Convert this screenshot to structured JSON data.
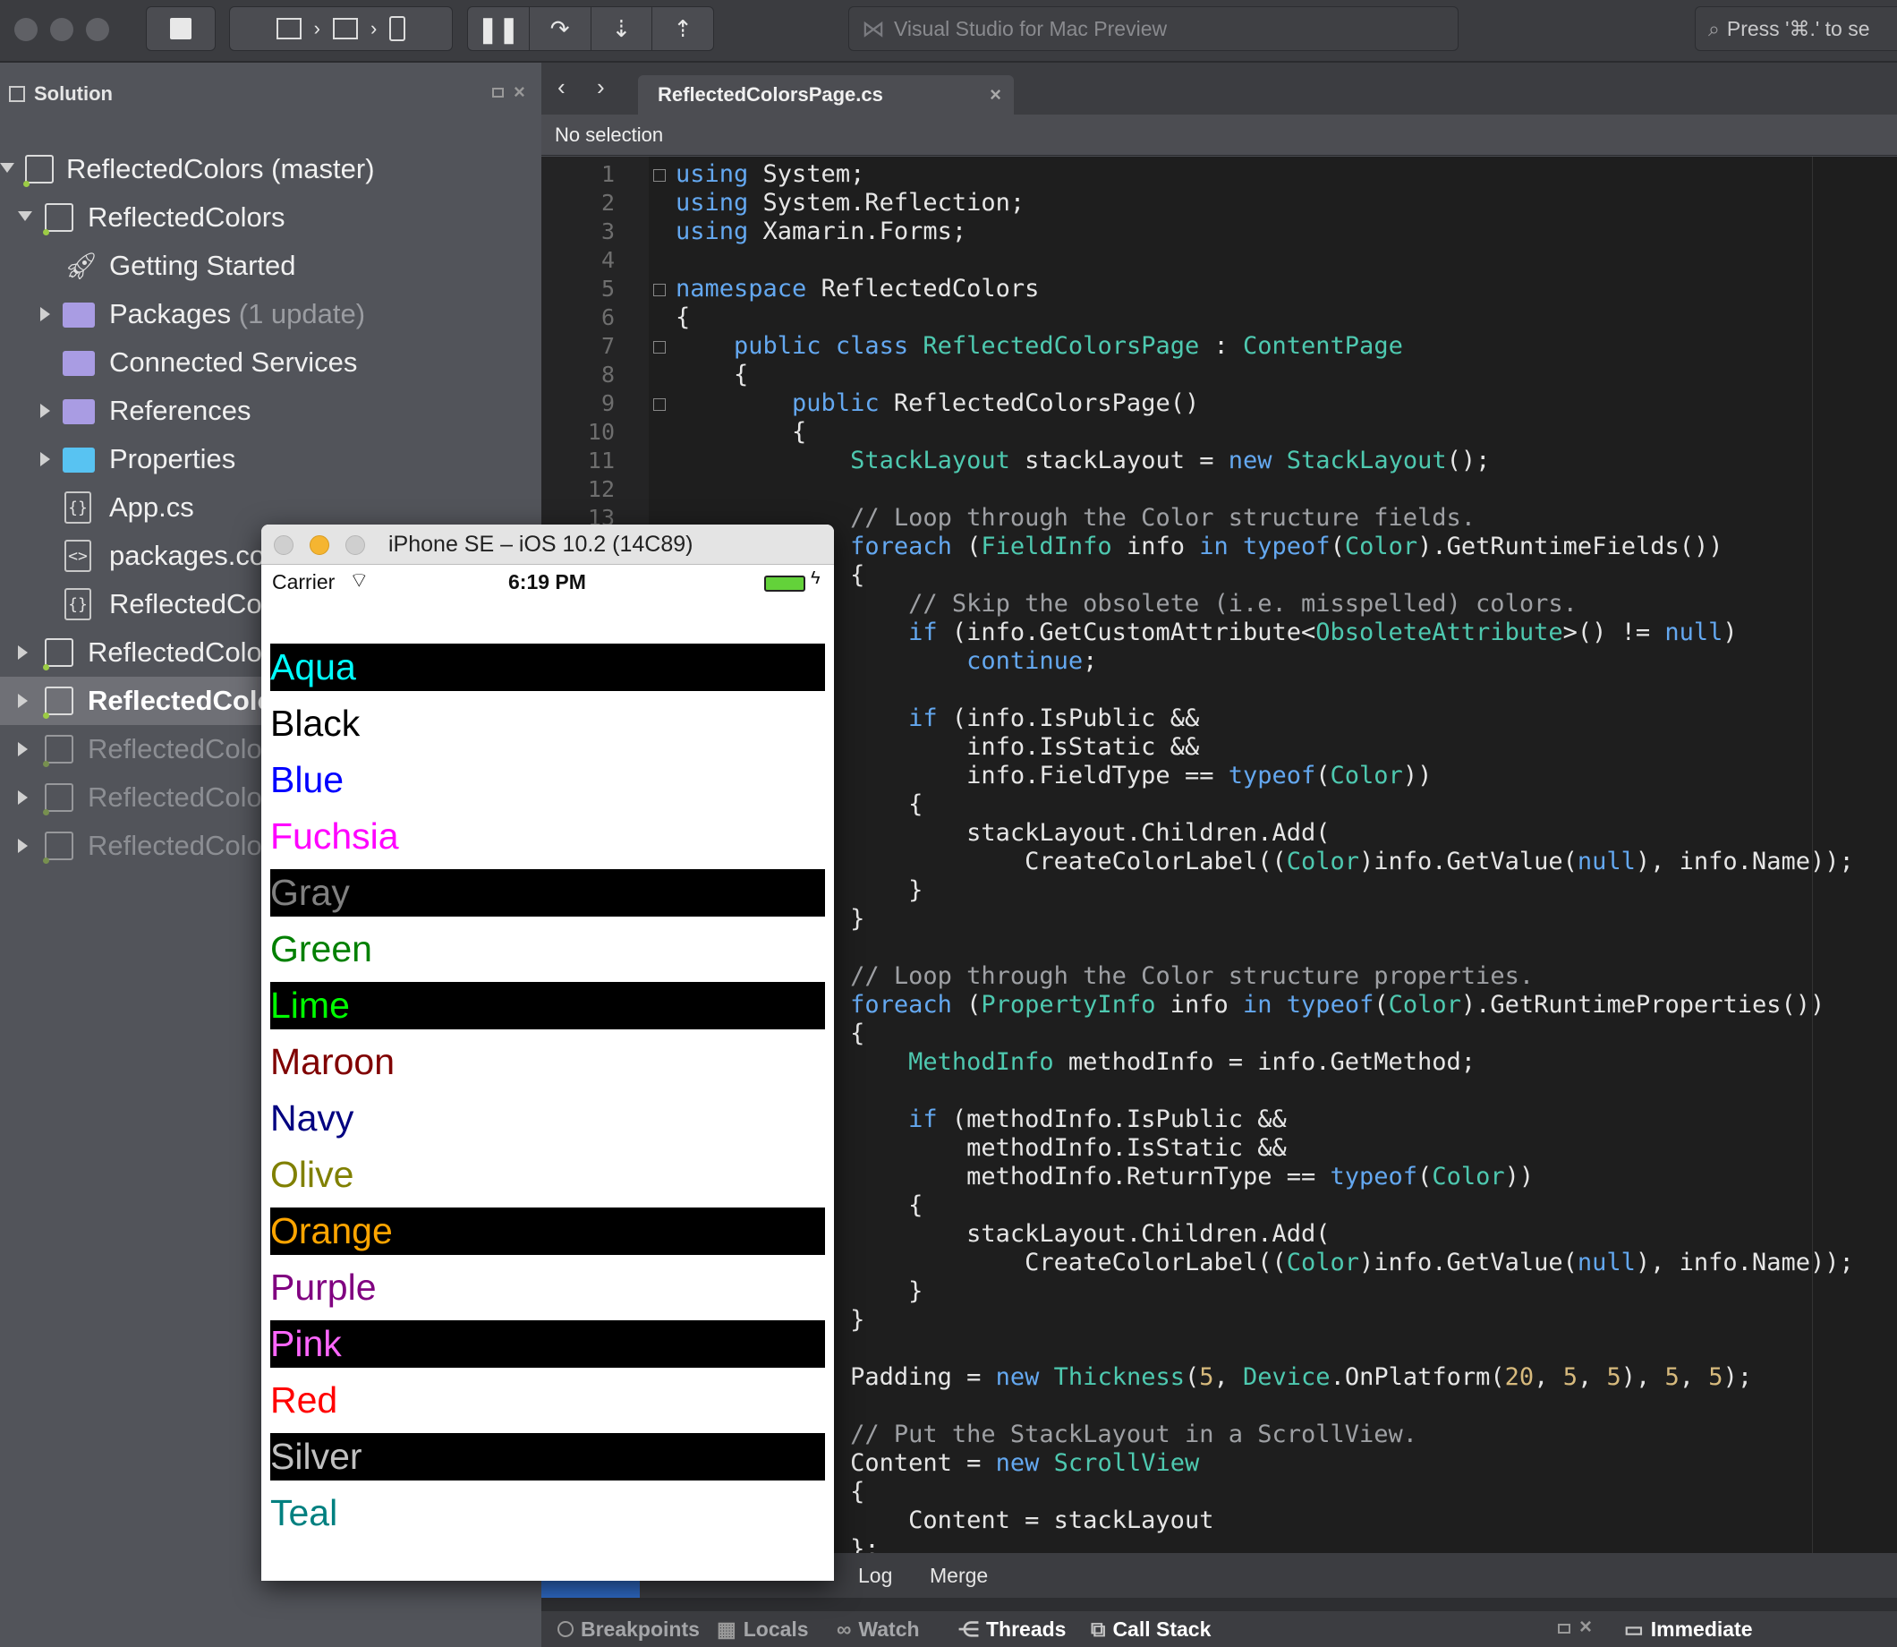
{
  "toolbar": {
    "status_text": "Visual Studio for Mac Preview",
    "search_text": "Press '⌘.' to se"
  },
  "solution": {
    "title": "Solution",
    "items": [
      {
        "label": "ReflectedColors (master)"
      },
      {
        "label": "ReflectedColors"
      },
      {
        "label": "Getting Started"
      },
      {
        "label": "Packages",
        "suffix": " (1 update)"
      },
      {
        "label": "Connected Services"
      },
      {
        "label": "References"
      },
      {
        "label": "Properties"
      },
      {
        "label": "App.cs"
      },
      {
        "label": "packages.config"
      },
      {
        "label": "ReflectedColors.cs"
      },
      {
        "label": "ReflectedColors.Droid"
      },
      {
        "label": "ReflectedColors.iOS"
      },
      {
        "label": "ReflectedColors.UWP"
      },
      {
        "label": "ReflectedColors.WinPhone"
      },
      {
        "label": "ReflectedColors.Windows"
      }
    ]
  },
  "editor": {
    "tab_title": "ReflectedColorsPage.cs",
    "path_text": "No selection",
    "line_numbers": [
      "1",
      "2",
      "3",
      "4",
      "5",
      "6",
      "7",
      "8",
      "9",
      "10",
      "11",
      "12",
      "13"
    ]
  },
  "vcs_tabs": {
    "log": "Log",
    "merge": "Merge"
  },
  "pads": {
    "breakpoints": "Breakpoints",
    "locals": "Locals",
    "watch": "Watch",
    "threads": "Threads",
    "callstack": "Call Stack",
    "immediate": "Immediate"
  },
  "simulator": {
    "title": "iPhone SE – iOS 10.2 (14C89)",
    "carrier": "Carrier",
    "time": "6:19 PM",
    "colors": [
      {
        "name": "Aqua",
        "color": "#00ffff",
        "bg": "#000000"
      },
      {
        "name": "Black",
        "color": "#000000",
        "bg": "#ffffff"
      },
      {
        "name": "Blue",
        "color": "#0000ff",
        "bg": "#ffffff"
      },
      {
        "name": "Fuchsia",
        "color": "#ff00ff",
        "bg": "#ffffff"
      },
      {
        "name": "Gray",
        "color": "#808080",
        "bg": "#000000"
      },
      {
        "name": "Green",
        "color": "#008000",
        "bg": "#ffffff"
      },
      {
        "name": "Lime",
        "color": "#00ff00",
        "bg": "#000000"
      },
      {
        "name": "Maroon",
        "color": "#800000",
        "bg": "#ffffff"
      },
      {
        "name": "Navy",
        "color": "#000080",
        "bg": "#ffffff"
      },
      {
        "name": "Olive",
        "color": "#808000",
        "bg": "#ffffff"
      },
      {
        "name": "Orange",
        "color": "#ffa500",
        "bg": "#000000"
      },
      {
        "name": "Purple",
        "color": "#800080",
        "bg": "#ffffff"
      },
      {
        "name": "Pink",
        "color": "#ff66ff",
        "bg": "#000000"
      },
      {
        "name": "Red",
        "color": "#ff0000",
        "bg": "#ffffff"
      },
      {
        "name": "Silver",
        "color": "#c0c0c0",
        "bg": "#000000"
      },
      {
        "name": "Teal",
        "color": "#008080",
        "bg": "#ffffff"
      }
    ]
  }
}
